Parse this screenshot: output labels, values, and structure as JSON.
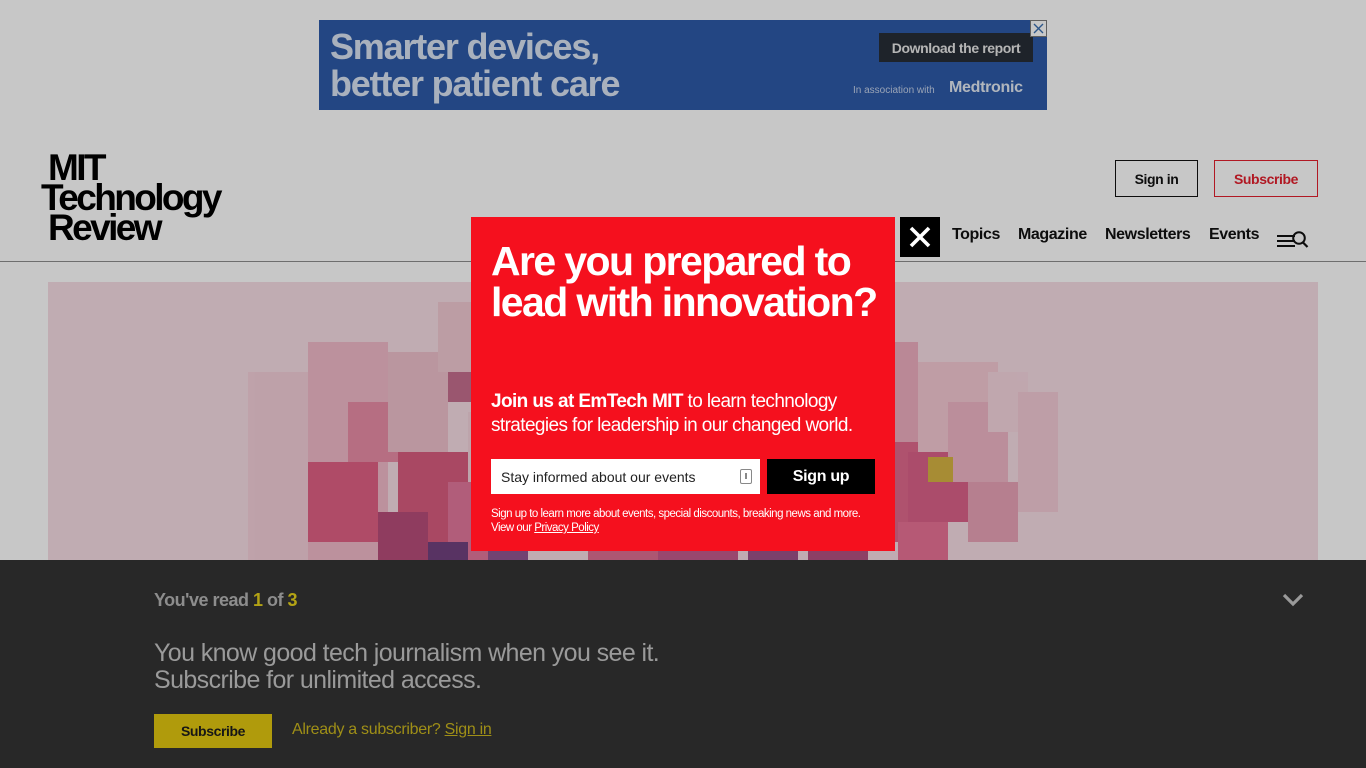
{
  "ad": {
    "headline_line1": "Smarter devices,",
    "headline_line2": "better patient care",
    "cta_label": "Download the report",
    "association_text": "In association with",
    "brand": "Medtronic",
    "close_icon": "close-icon",
    "background_color": "#2d5aa8"
  },
  "header": {
    "logo": {
      "line1": "MIT",
      "line2": "Technology",
      "line3": "Review"
    },
    "signin_label": "Sign in",
    "subscribe_label": "Subscribe",
    "nav": {
      "topics": "Topics",
      "magazine": "Magazine",
      "newsletters": "Newsletters",
      "events": "Events"
    },
    "menu_icon": "menu-icon",
    "search_icon": "search-icon"
  },
  "modal": {
    "title": "Are you prepared to lead with innovation?",
    "body_bold": "Join us at EmTech MIT",
    "body_rest": " to learn technology strategies for leadership in our changed world.",
    "email_placeholder": "Stay informed about our events",
    "signup_label": "Sign up",
    "fine_print": "Sign up to learn more about events, special discounts, breaking news and more. View our ",
    "privacy_link": "Privacy Policy",
    "close_icon": "close-icon",
    "background_color": "#f5101e"
  },
  "paywall": {
    "count_prefix": "You've read ",
    "count_read": "1",
    "count_of": " of ",
    "count_total": "3",
    "message_line1": "You know good tech journalism when you see it.",
    "message_line2": "Subscribe for unlimited access.",
    "subscribe_label": "Subscribe",
    "already_text": "Already a subscriber? ",
    "signin_link": "Sign in",
    "collapse_icon": "chevron-down-icon",
    "accent_color": "#b3a315"
  }
}
